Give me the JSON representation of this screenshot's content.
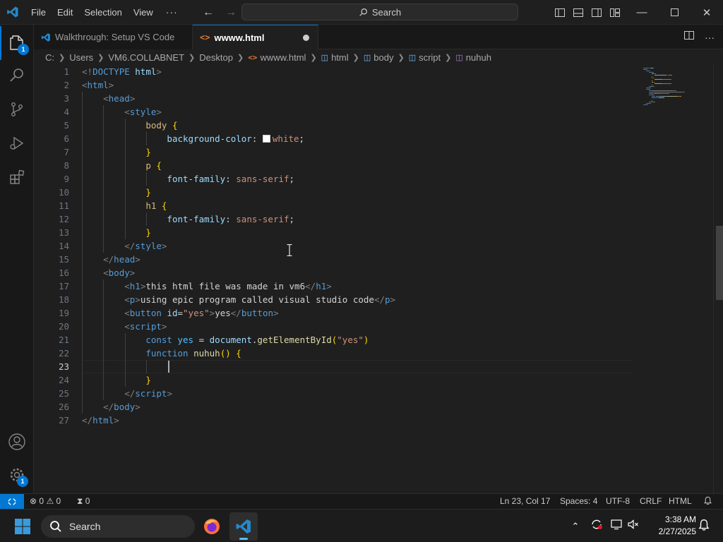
{
  "titlebar": {
    "menu": [
      "File",
      "Edit",
      "Selection",
      "View"
    ],
    "more": "···",
    "search_label": "Search"
  },
  "activity": {
    "explorer_badge": "1",
    "manage_badge": "1"
  },
  "tabs": [
    {
      "label": "Walkthrough: Setup VS Code",
      "active": false
    },
    {
      "label": "wwww.html",
      "active": true,
      "modified": true
    }
  ],
  "breadcrumb": [
    "C:",
    "Users",
    "VM6.COLLABNET",
    "Desktop",
    "wwww.html",
    "html",
    "body",
    "script",
    "nuhuh"
  ],
  "editor": {
    "current_line": 23,
    "line_numbers": [
      "1",
      "2",
      "3",
      "4",
      "5",
      "6",
      "7",
      "8",
      "9",
      "10",
      "11",
      "12",
      "13",
      "14",
      "15",
      "16",
      "17",
      "18",
      "19",
      "20",
      "21",
      "22",
      "23",
      "24",
      "25",
      "26",
      "27"
    ],
    "lines": [
      [
        [
          "<!",
          "t-punc"
        ],
        [
          "DOCTYPE",
          "t-tag"
        ],
        [
          " ",
          "t-text"
        ],
        [
          "html",
          "t-attr"
        ],
        [
          ">",
          "t-punc"
        ]
      ],
      [
        [
          "<",
          "t-punc"
        ],
        [
          "html",
          "t-tag"
        ],
        [
          ">",
          "t-punc"
        ]
      ],
      [
        [
          "    ",
          "t-text"
        ],
        [
          "<",
          "t-punc"
        ],
        [
          "head",
          "t-tag"
        ],
        [
          ">",
          "t-punc"
        ]
      ],
      [
        [
          "        ",
          "t-text"
        ],
        [
          "<",
          "t-punc"
        ],
        [
          "style",
          "t-tag"
        ],
        [
          ">",
          "t-punc"
        ]
      ],
      [
        [
          "            ",
          "t-text"
        ],
        [
          "body",
          "t-sel"
        ],
        [
          " ",
          "t-text"
        ],
        [
          "{",
          "t-brk"
        ]
      ],
      [
        [
          "                ",
          "t-text"
        ],
        [
          "background-color",
          "t-attr"
        ],
        [
          ": ",
          "t-text"
        ],
        [
          "SWATCH",
          "swatch"
        ],
        [
          "white",
          "t-str"
        ],
        [
          ";",
          "t-text"
        ]
      ],
      [
        [
          "            ",
          "t-text"
        ],
        [
          "}",
          "t-brk"
        ]
      ],
      [
        [
          "            ",
          "t-text"
        ],
        [
          "p",
          "t-sel"
        ],
        [
          " ",
          "t-text"
        ],
        [
          "{",
          "t-brk"
        ]
      ],
      [
        [
          "                ",
          "t-text"
        ],
        [
          "font-family",
          "t-attr"
        ],
        [
          ": ",
          "t-text"
        ],
        [
          "sans-serif",
          "t-str"
        ],
        [
          ";",
          "t-text"
        ]
      ],
      [
        [
          "            ",
          "t-text"
        ],
        [
          "}",
          "t-brk"
        ]
      ],
      [
        [
          "            ",
          "t-text"
        ],
        [
          "h1",
          "t-sel"
        ],
        [
          " ",
          "t-text"
        ],
        [
          "{",
          "t-brk"
        ]
      ],
      [
        [
          "                ",
          "t-text"
        ],
        [
          "font-family",
          "t-attr"
        ],
        [
          ": ",
          "t-text"
        ],
        [
          "sans-serif",
          "t-str"
        ],
        [
          ";",
          "t-text"
        ]
      ],
      [
        [
          "            ",
          "t-text"
        ],
        [
          "}",
          "t-brk"
        ]
      ],
      [
        [
          "        ",
          "t-text"
        ],
        [
          "</",
          "t-punc"
        ],
        [
          "style",
          "t-tag"
        ],
        [
          ">",
          "t-punc"
        ]
      ],
      [
        [
          "    ",
          "t-text"
        ],
        [
          "</",
          "t-punc"
        ],
        [
          "head",
          "t-tag"
        ],
        [
          ">",
          "t-punc"
        ]
      ],
      [
        [
          "    ",
          "t-text"
        ],
        [
          "<",
          "t-punc"
        ],
        [
          "body",
          "t-tag"
        ],
        [
          ">",
          "t-punc"
        ]
      ],
      [
        [
          "        ",
          "t-text"
        ],
        [
          "<",
          "t-punc"
        ],
        [
          "h1",
          "t-tag"
        ],
        [
          ">",
          "t-punc"
        ],
        [
          "this html file was made in vm6",
          "t-text"
        ],
        [
          "</",
          "t-punc"
        ],
        [
          "h1",
          "t-tag"
        ],
        [
          ">",
          "t-punc"
        ]
      ],
      [
        [
          "        ",
          "t-text"
        ],
        [
          "<",
          "t-punc"
        ],
        [
          "p",
          "t-tag"
        ],
        [
          ">",
          "t-punc"
        ],
        [
          "using epic program called visual studio code",
          "t-text"
        ],
        [
          "</",
          "t-punc"
        ],
        [
          "p",
          "t-tag"
        ],
        [
          ">",
          "t-punc"
        ]
      ],
      [
        [
          "        ",
          "t-text"
        ],
        [
          "<",
          "t-punc"
        ],
        [
          "button",
          "t-tag"
        ],
        [
          " ",
          "t-text"
        ],
        [
          "id",
          "t-attr"
        ],
        [
          "=",
          "t-text"
        ],
        [
          "\"yes\"",
          "t-str"
        ],
        [
          ">",
          "t-punc"
        ],
        [
          "yes",
          "t-text"
        ],
        [
          "</",
          "t-punc"
        ],
        [
          "button",
          "t-tag"
        ],
        [
          ">",
          "t-punc"
        ]
      ],
      [
        [
          "        ",
          "t-text"
        ],
        [
          "<",
          "t-punc"
        ],
        [
          "script",
          "t-tag"
        ],
        [
          ">",
          "t-punc"
        ]
      ],
      [
        [
          "            ",
          "t-text"
        ],
        [
          "const",
          "t-kw"
        ],
        [
          " ",
          "t-text"
        ],
        [
          "yes",
          "t-var"
        ],
        [
          " = ",
          "t-text"
        ],
        [
          "document",
          "t-vr"
        ],
        [
          ".",
          "t-text"
        ],
        [
          "getElementById",
          "t-fn"
        ],
        [
          "(",
          "t-brk"
        ],
        [
          "\"yes\"",
          "t-str"
        ],
        [
          ")",
          "t-brk"
        ]
      ],
      [
        [
          "            ",
          "t-text"
        ],
        [
          "function",
          "t-kw"
        ],
        [
          " ",
          "t-text"
        ],
        [
          "nuhuh",
          "t-fn"
        ],
        [
          "() ",
          "t-brk"
        ],
        [
          "{",
          "t-brk"
        ]
      ],
      [
        [
          "",
          "t-text"
        ]
      ],
      [
        [
          "            ",
          "t-text"
        ],
        [
          "}",
          "t-brk"
        ]
      ],
      [
        [
          "        ",
          "t-text"
        ],
        [
          "</",
          "t-punc"
        ],
        [
          "script",
          "t-tag"
        ],
        [
          ">",
          "t-punc"
        ]
      ],
      [
        [
          "    ",
          "t-text"
        ],
        [
          "</",
          "t-punc"
        ],
        [
          "body",
          "t-tag"
        ],
        [
          ">",
          "t-punc"
        ]
      ],
      [
        [
          "</",
          "t-punc"
        ],
        [
          "html",
          "t-tag"
        ],
        [
          ">",
          "t-punc"
        ]
      ]
    ]
  },
  "statusbar": {
    "errors": "0",
    "warnings": "0",
    "ports": "0",
    "position": "Ln 23, Col 17",
    "spaces": "Spaces: 4",
    "encoding": "UTF-8",
    "eol": "CRLF",
    "language": "HTML"
  },
  "taskbar": {
    "search_label": "Search",
    "time": "3:38 AM",
    "date": "2/27/2025"
  },
  "colors": {
    "accent": "#0078d4",
    "tag": "#569cd6",
    "attribute": "#9cdcfe",
    "string": "#ce9178",
    "function": "#dcdcaa",
    "bracket": "#ffd700"
  }
}
